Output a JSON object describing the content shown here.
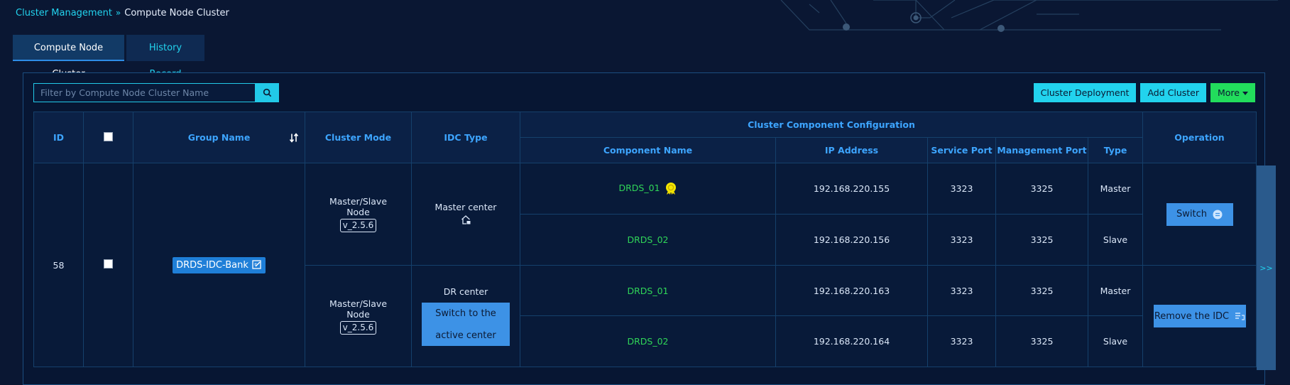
{
  "breadcrumb": {
    "parent": "Cluster Management",
    "current": "Compute Node Cluster"
  },
  "tabs": [
    {
      "label": "Compute Node Cluster",
      "active": true
    },
    {
      "label": "History Record",
      "active": false
    }
  ],
  "search": {
    "placeholder": "Filter by Compute Node Cluster Name",
    "value": ""
  },
  "actions": {
    "deploy": "Cluster Deployment",
    "add": "Add Cluster",
    "more": "More"
  },
  "table": {
    "headers": {
      "id": "ID",
      "group": "Group Name",
      "mode": "Cluster Mode",
      "idc": "IDC Type",
      "config": "Cluster Component Configuration",
      "component": "Component Name",
      "ip": "IP Address",
      "sport": "Service Port",
      "mport": "Management Port",
      "type": "Type",
      "operation": "Operation"
    },
    "row": {
      "id": "58",
      "group": "DRDS-IDC-Bank",
      "idcs": [
        {
          "mode_line1": "Master/Slave",
          "mode_line2": "Node",
          "version": "v_2.5.6",
          "idc": "Master center",
          "operation": "Switch",
          "components": [
            {
              "name": "DRDS_01",
              "ip": "192.168.220.155",
              "sport": "3323",
              "mport": "3325",
              "type": "Master"
            },
            {
              "name": "DRDS_02",
              "ip": "192.168.220.156",
              "sport": "3323",
              "mport": "3325",
              "type": "Slave"
            }
          ]
        },
        {
          "mode_line1": "Master/Slave",
          "mode_line2": "Node",
          "version": "v_2.5.6",
          "idc": "DR center",
          "switch_btn_line1": "Switch to the",
          "switch_btn_line2": "active center",
          "operation": "Remove the IDC",
          "components": [
            {
              "name": "DRDS_01",
              "ip": "192.168.220.163",
              "sport": "3323",
              "mport": "3325",
              "type": "Master"
            },
            {
              "name": "DRDS_02",
              "ip": "192.168.220.164",
              "sport": "3323",
              "mport": "3325",
              "type": "Slave"
            }
          ]
        }
      ]
    }
  },
  "expander": ">>",
  "colors": {
    "accent": "#22d3ee",
    "green": "#22dd5c",
    "header_text": "#3da5ff",
    "button_blue": "#3d92e6"
  }
}
